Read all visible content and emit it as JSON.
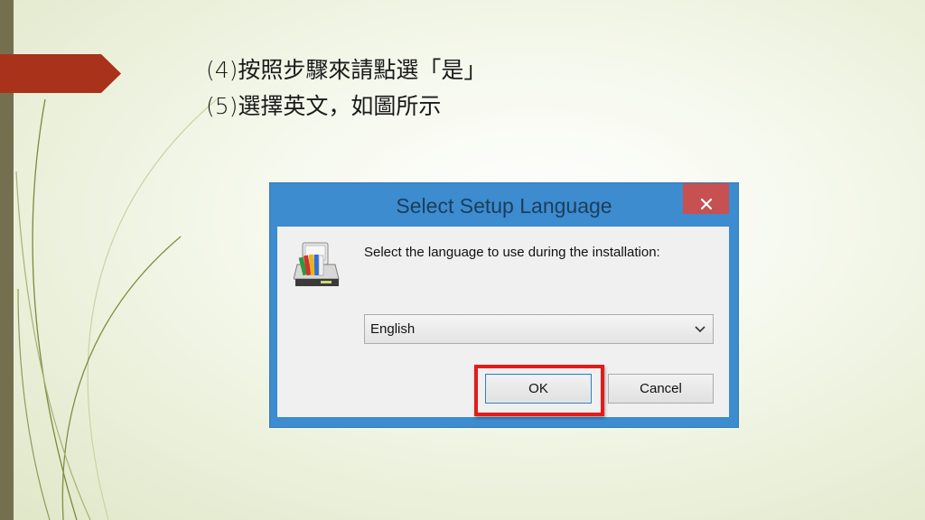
{
  "slide": {
    "line1": "(4)按照步驟來請點選「是」",
    "line2": "(5)選擇英文，如圖所示"
  },
  "dialog": {
    "title": "Select Setup Language",
    "close_label": "✕",
    "prompt": "Select the language to use during the installation:",
    "language_selected": "English",
    "ok_label": "OK",
    "cancel_label": "Cancel"
  },
  "colors": {
    "titlebar": "#3c8ccf",
    "close_button": "#c75050",
    "highlight_box": "#e31b1b",
    "arrow_tab": "#a8321a",
    "left_bar": "#74704f"
  },
  "icons": {
    "setup": "setup-icon",
    "dropdown": "chevron-down-icon",
    "close": "close-icon"
  }
}
